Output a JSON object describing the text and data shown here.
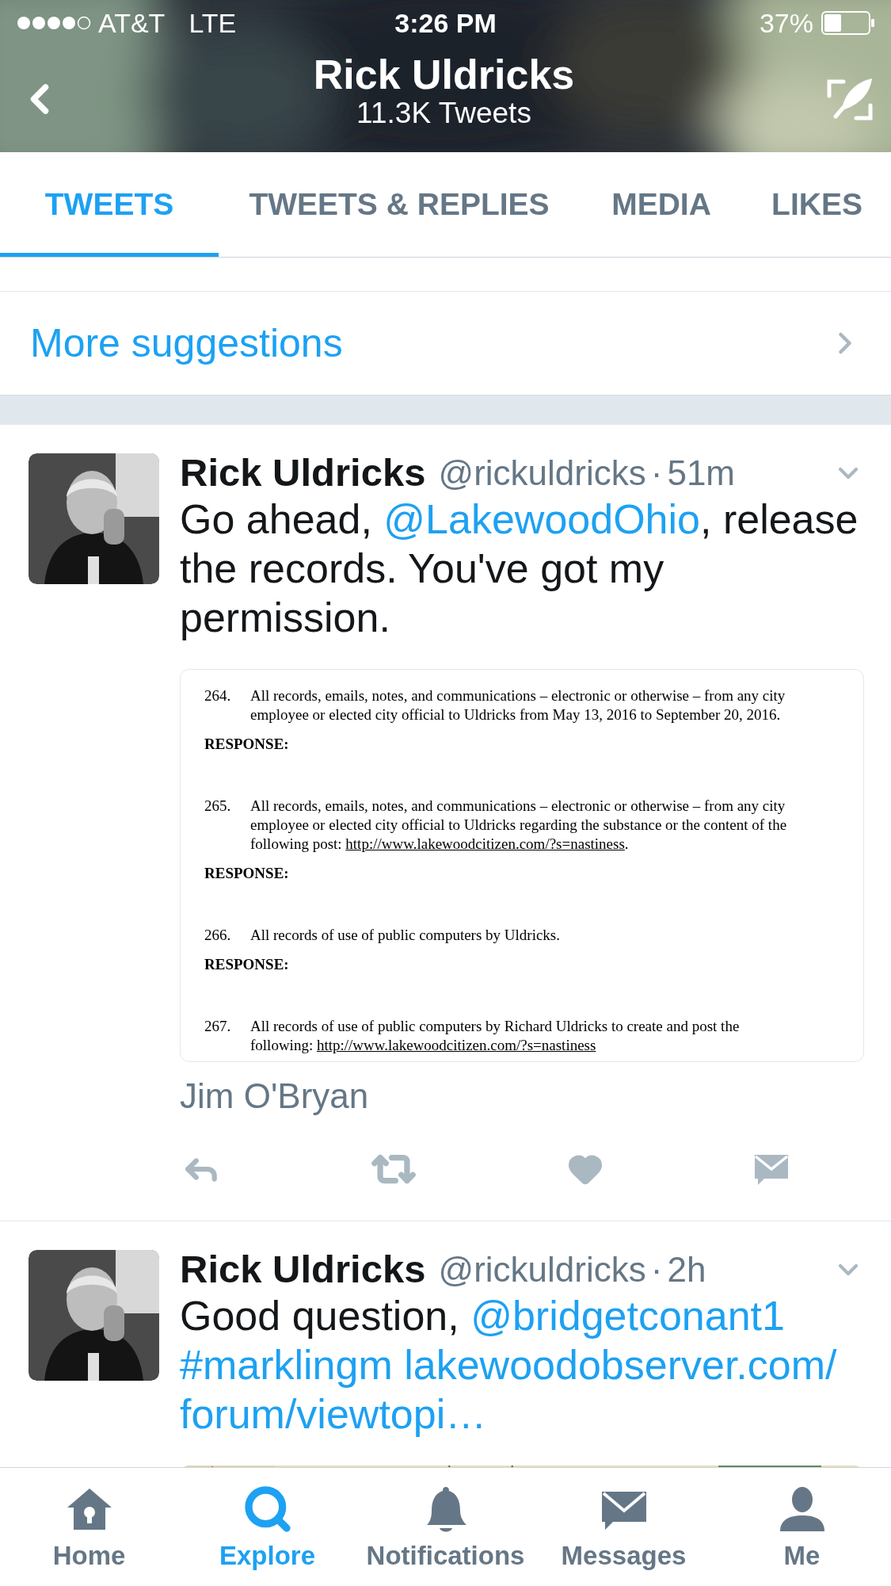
{
  "status_bar": {
    "carrier": "AT&T",
    "network": "LTE",
    "time": "3:26 PM",
    "battery": "37%"
  },
  "header": {
    "title": "Rick Uldricks",
    "subtitle": "11.3K Tweets"
  },
  "tabs": [
    {
      "label": "TWEETS",
      "selected": true
    },
    {
      "label": "TWEETS & REPLIES",
      "selected": false
    },
    {
      "label": "MEDIA",
      "selected": false
    },
    {
      "label": "LIKES",
      "selected": false
    }
  ],
  "suggestions_link": "More suggestions",
  "tweets": [
    {
      "name": "Rick Uldricks",
      "handle": "@rickuldricks",
      "separator": "·",
      "time": "51m",
      "text": [
        {
          "kind": "plain",
          "text": "Go ahead, "
        },
        {
          "kind": "link",
          "text": "@LakewoodOhio"
        },
        {
          "kind": "plain",
          "text": ", release the records. You've got my permission."
        }
      ],
      "media": {
        "kind": "document",
        "items": [
          {
            "kind": "request",
            "number": "264.",
            "lines": [
              "All records, emails, notes, and communications – electronic or otherwise – from any city",
              "employee or elected city official to Uldricks from May 13, 2016 to September 20, 2016."
            ]
          },
          {
            "kind": "response",
            "label": "RESPONSE:"
          },
          {
            "kind": "request",
            "number": "265.",
            "lines": [
              "All records, emails, notes, and communications – electronic or otherwise – from any city",
              "employee or elected city official to Uldricks regarding the substance or the content of the",
              "following post: "
            ],
            "url": "http://www.lakewoodcitizen.com/?s=nastiness",
            "after_url": "."
          },
          {
            "kind": "response",
            "label": "RESPONSE:"
          },
          {
            "kind": "request",
            "number": "266.",
            "lines": [
              "All records of use of public computers by Uldricks."
            ]
          },
          {
            "kind": "response",
            "label": "RESPONSE:"
          },
          {
            "kind": "request",
            "number": "267.",
            "lines": [
              "All records of use of public computers by Richard Uldricks to create and post the",
              "following: "
            ],
            "url": "http://www.lakewoodcitizen.com/?s=nastiness"
          }
        ]
      },
      "media_credit": "Jim O'Bryan",
      "actions": true
    },
    {
      "name": "Rick Uldricks",
      "handle": "@rickuldricks",
      "separator": "·",
      "time": "2h",
      "text": [
        {
          "kind": "plain",
          "text": "Good question, "
        },
        {
          "kind": "link",
          "text": "@bridgetconant1"
        },
        {
          "kind": "link",
          "text": "#marklingm"
        },
        {
          "kind": "link",
          "text": "lakewoodobserver.com/"
        },
        {
          "kind": "link_continued",
          "text": "forum/viewtopi…"
        }
      ],
      "actions": false
    }
  ],
  "nav": [
    {
      "label": "Home",
      "kind": "home",
      "selected": false
    },
    {
      "label": "Explore",
      "kind": "search",
      "selected": true
    },
    {
      "label": "Notifications",
      "kind": "bell",
      "selected": false
    },
    {
      "label": "Messages",
      "kind": "mail",
      "selected": false
    },
    {
      "label": "Me",
      "kind": "user",
      "selected": false
    }
  ]
}
